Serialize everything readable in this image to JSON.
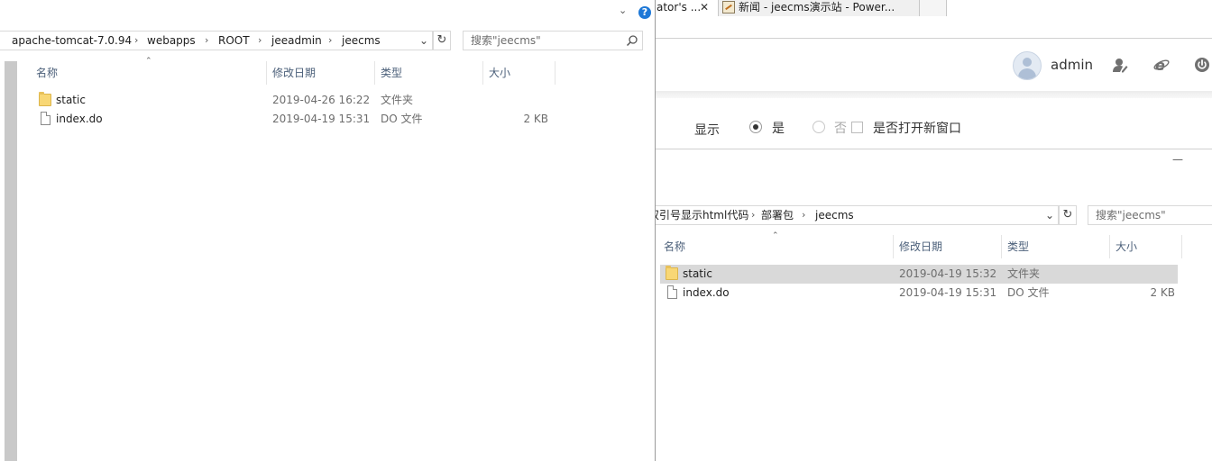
{
  "browser": {
    "tabs": [
      {
        "label": "ator's ...",
        "close": "✕"
      },
      {
        "label": "新闻 - jeecms演示站 - Power..."
      },
      {
        "label": ""
      }
    ],
    "header": {
      "username": "admin",
      "icons": [
        "user-edit-icon",
        "ie-icon",
        "power-icon"
      ]
    },
    "form": {
      "label": "显示",
      "radio_yes": "是",
      "radio_no": "否",
      "checkbox_label": "是否打开新窗口"
    }
  },
  "explorer_front": {
    "breadcrumb": [
      "apache-tomcat-7.0.94",
      "webapps",
      "ROOT",
      "jeeadmin",
      "jeecms"
    ],
    "search_placeholder": "搜索\"jeecms\"",
    "columns": {
      "name": "名称",
      "date": "修改日期",
      "type": "类型",
      "size": "大小"
    },
    "files": [
      {
        "name": "static",
        "date": "2019-04-26 16:22",
        "type": "文件夹",
        "size": "",
        "icon": "folder-icon"
      },
      {
        "name": "index.do",
        "date": "2019-04-19 15:31",
        "type": "DO 文件",
        "size": "2 KB",
        "icon": "file-icon"
      }
    ]
  },
  "explorer_back": {
    "minimize": "—",
    "breadcrumb": [
      "双引号显示html代码",
      "部署包",
      "jeecms"
    ],
    "search_placeholder": "搜索\"jeecms\"",
    "columns": {
      "name": "名称",
      "date": "修改日期",
      "type": "类型",
      "size": "大小"
    },
    "files": [
      {
        "name": "static",
        "date": "2019-04-19 15:32",
        "type": "文件夹",
        "size": "",
        "icon": "folder-icon",
        "selected": true
      },
      {
        "name": "index.do",
        "date": "2019-04-19 15:31",
        "type": "DO 文件",
        "size": "2 KB",
        "icon": "file-icon"
      }
    ]
  },
  "colors": {
    "column_header_text": "#4c607a",
    "selection": "#d9d9d9",
    "folder": "#f8d775",
    "help_blue": "#1e78d7"
  }
}
